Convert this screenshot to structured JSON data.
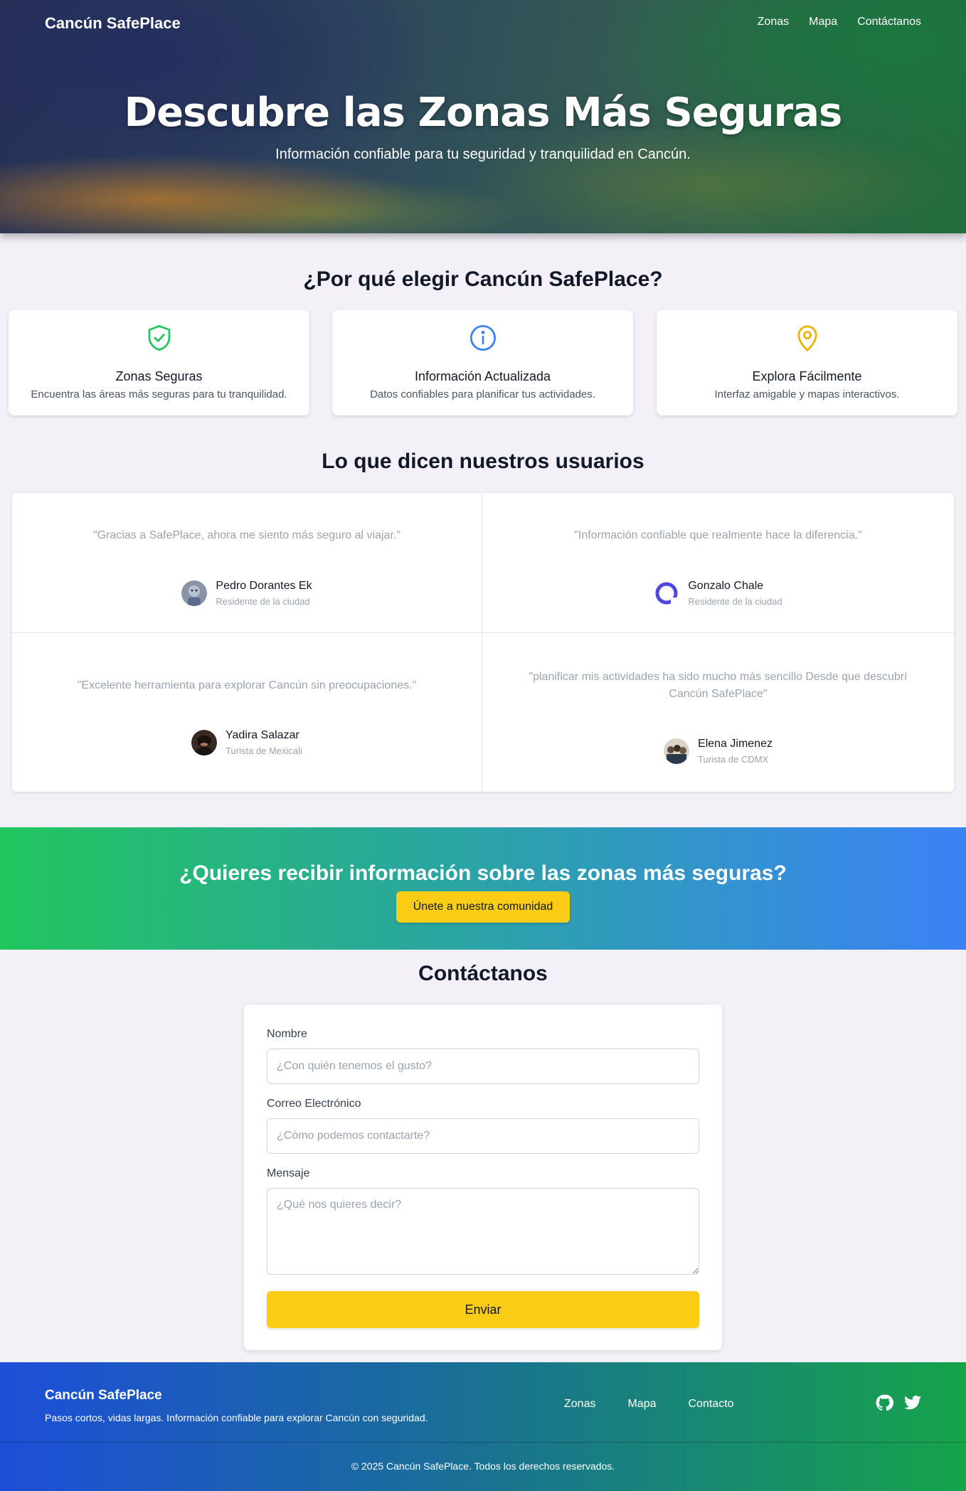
{
  "nav": {
    "brand": "Cancún SafePlace",
    "links": [
      "Zonas",
      "Mapa",
      "Contáctanos"
    ]
  },
  "hero": {
    "title": "Descubre las Zonas Más Seguras",
    "subtitle": "Información confiable para tu seguridad y tranquilidad en Cancún."
  },
  "why": {
    "title": "¿Por qué elegir Cancún SafePlace?",
    "features": [
      {
        "icon": "shield-check-icon",
        "color": "#22c55e",
        "title": "Zonas Seguras",
        "text": "Encuentra las áreas más seguras para tu tranquilidad."
      },
      {
        "icon": "info-icon",
        "color": "#3b82f6",
        "title": "Información Actualizada",
        "text": "Datos confiables para planificar tus actividades."
      },
      {
        "icon": "map-pin-icon",
        "color": "#eab308",
        "title": "Explora Fácilmente",
        "text": "Interfaz amigable y mapas interactivos."
      }
    ]
  },
  "testimonials": {
    "title": "Lo que dicen nuestros usuarios",
    "items": [
      {
        "quote": "\"Gracias a SafePlace, ahora me siento más seguro al viajar.\"",
        "name": "Pedro Dorantes Ek",
        "role": "Residente de la ciudad"
      },
      {
        "quote": "\"Información confiable que realmente hace la diferencia.\"",
        "name": "Gonzalo Chale",
        "role": "Residente de la ciudad"
      },
      {
        "quote": "\"Excelente herramienta para explorar Cancún sin preocupaciones.\"",
        "name": "Yadira Salazar",
        "role": "Turista de Mexicali"
      },
      {
        "quote": "\"planificar mis actividades ha sido mucho más sencillo Desde que descubrí Cancún SafePlace\"",
        "name": "Elena Jimenez",
        "role": "Turista de CDMX"
      }
    ]
  },
  "cta": {
    "title": "¿Quieres recibir información sobre las zonas más seguras?",
    "button": "Únete a nuestra comunidad"
  },
  "contact": {
    "title": "Contáctanos",
    "name_label": "Nombre",
    "name_placeholder": "¿Con quién tenemos el gusto?",
    "email_label": "Correo Electrónico",
    "email_placeholder": "¿Cómo podemos contactarte?",
    "message_label": "Mensaje",
    "message_placeholder": "¿Qué nos quieres decir?",
    "submit": "Enviar"
  },
  "footer": {
    "brand": "Cancún SafePlace",
    "tagline": "Pasos cortos, vidas largas. Información confiable para explorar Cancún con seguridad.",
    "links": [
      "Zonas",
      "Mapa",
      "Contacto"
    ],
    "social": [
      "github-icon",
      "twitter-icon"
    ],
    "copyright": "© 2025 Cancún SafePlace. Todos los derechos reservados."
  }
}
